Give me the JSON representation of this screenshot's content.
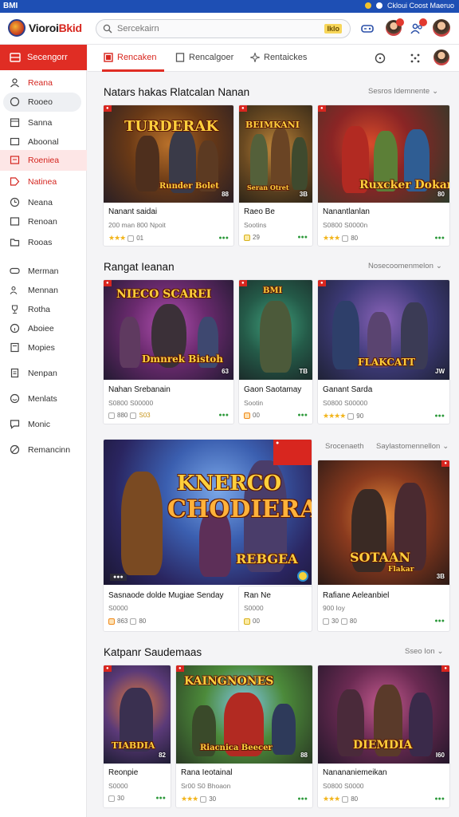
{
  "status_bar": {
    "left": "BMI",
    "right": "Ckloui Coost Maeruo"
  },
  "header": {
    "logo_text_a": "Vioroi",
    "logo_text_b": "Bkid",
    "search_placeholder": "Sercekairn",
    "search_badge": "Iklo"
  },
  "sidebar": {
    "active": "Secengorr",
    "items": [
      "Reana",
      "Rooeo",
      "Sanna",
      "Aboonal",
      "Roeniea",
      "Natinea",
      "Neana",
      "Renoan",
      "Rooas",
      "Merman",
      "Mennan",
      "Rotha",
      "Aboiee",
      "Mopies",
      "Nenpan",
      "Menlats",
      "Monic",
      "Remancinn"
    ]
  },
  "tabs": [
    "Rencaken",
    "Rencalgoer",
    "Rentaickes"
  ],
  "sections": [
    {
      "title": "Natars hakas Rlatcalan Nanan",
      "more": "Sesros Idemnente",
      "cards": [
        {
          "name": "Nanant saidai",
          "meta": "200 man  800 Npoit",
          "rating": "★★★",
          "count": "01",
          "art_title": "TURDERAK",
          "art_sub": "Runder Bolet",
          "num": "88"
        },
        {
          "name": "Raeo Be",
          "meta": "Sootins",
          "rating": "",
          "count": "29",
          "art_title": "BEIMKANI",
          "art_sub": "Seran Otret",
          "num": "3B"
        },
        {
          "name": "Nanantlanlan",
          "meta": "S0800 S0000n",
          "rating": "★★★",
          "count": "80",
          "art_title": "Ruxcker Dokar",
          "art_sub": "",
          "num": "80"
        }
      ]
    },
    {
      "title": "Rangat Ieanan",
      "more": "Nosecoomenmelon",
      "cards": [
        {
          "name": "Nahan Srebanain",
          "meta": "S0800 S00000",
          "rating": "",
          "count": "880",
          "count2": "S03",
          "art_title": "NIECO SCAREI",
          "art_sub": "Dmnrek Bistoh",
          "num": "63"
        },
        {
          "name": "Gaon Saotamay",
          "meta": "Sootin",
          "rating": "",
          "count": "00",
          "art_title": "BMI",
          "art_sub": "",
          "num": "TB"
        },
        {
          "name": "Ganant Sarda",
          "meta": "S0800 S00000",
          "rating": "★★★★",
          "count": "90",
          "art_title": "FLAKCATT",
          "art_sub": "",
          "num": "JW"
        }
      ]
    },
    {
      "title": "",
      "more_a": "Srocenaeth",
      "more_b": "Saylastomennellon",
      "cards": [
        {
          "name": "Sasnaode dolde Mugiae Senday",
          "meta": "S0000",
          "rating": "",
          "count": "863",
          "count2": "80",
          "art_title": "KNERCO",
          "art_title2": "CHODIERA",
          "art_sub": "REBGEA",
          "num": ""
        },
        {
          "name": "Ran Ne",
          "meta": "S0000",
          "rating": "",
          "count": "00",
          "art_title": "",
          "art_sub": "",
          "num": ""
        },
        {
          "name": "Rafiane Aeleanbiel",
          "meta": "900 Ioy",
          "rating": "",
          "count": "30",
          "count2": "80",
          "art_title": "SOTAAN",
          "art_sub": "Flakar",
          "num": "3B"
        }
      ]
    },
    {
      "title": "Katpanr Saudemaas",
      "more": "Sseo Ion",
      "cards": [
        {
          "name": "Reonpie",
          "meta": "S0000",
          "rating": "",
          "count": "30",
          "art_title": "TIABDIA",
          "art_sub": "",
          "num": "82"
        },
        {
          "name": "Rana Ieotainal",
          "meta": "Sr00 S0 Bhoaon",
          "rating": "★★★",
          "count": "30",
          "art_title": "KAINGNONES",
          "art_sub": "Riacnica Beecer",
          "num": "88"
        },
        {
          "name": "Nanananiemeikan",
          "meta": "S0800 S0000",
          "rating": "★★★",
          "count": "80",
          "art_title": "DIEMDIA",
          "art_sub": "",
          "num": "I60"
        }
      ]
    }
  ],
  "colors": {
    "accent": "#e02d24",
    "statusbar": "#1e4fb4",
    "star": "#f2b51c",
    "green": "#2e9a3c"
  }
}
